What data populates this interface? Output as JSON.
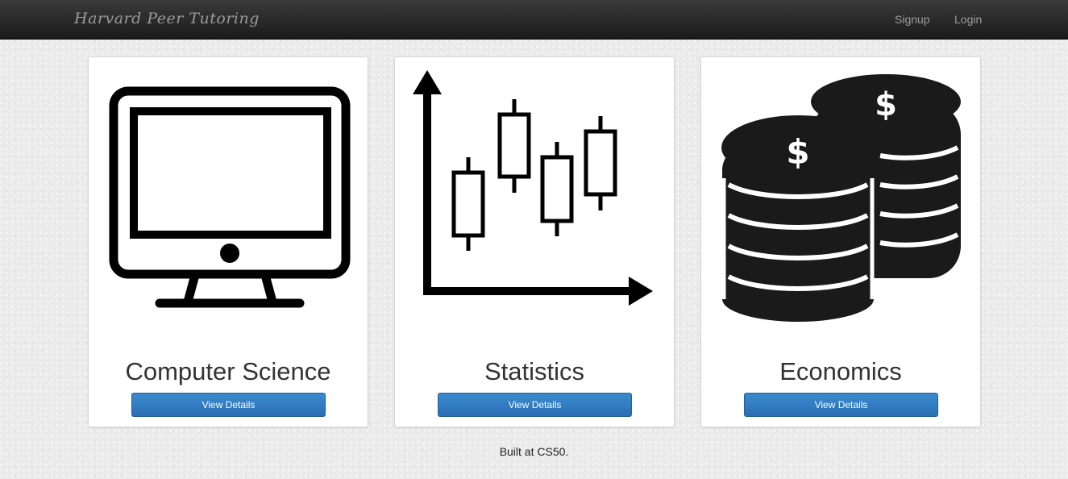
{
  "navbar": {
    "brand": "Harvard Peer Tutoring",
    "signup_label": "Signup",
    "login_label": "Login"
  },
  "cards": [
    {
      "title": "Computer Science",
      "button_label": "View Details",
      "icon": "computer-monitor-icon"
    },
    {
      "title": "Statistics",
      "button_label": "View Details",
      "icon": "candlestick-chart-icon"
    },
    {
      "title": "Economics",
      "button_label": "View Details",
      "icon": "coin-stacks-icon"
    }
  ],
  "footer": {
    "text": "Built at CS50."
  }
}
